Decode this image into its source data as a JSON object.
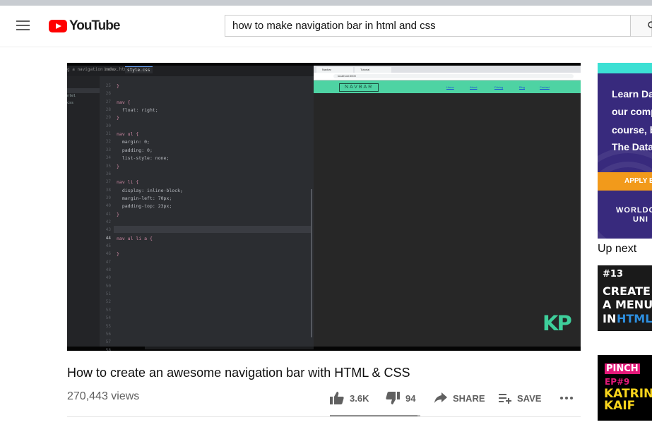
{
  "header": {
    "logo_text": "YouTube",
    "search_value": "how to make navigation bar in html and css"
  },
  "player": {
    "editor_tabs": [
      "g a navigation menu",
      "index.html",
      "style.css"
    ],
    "tree_items": [
      "",
      "ntel",
      "css"
    ],
    "line_numbers": [
      "25",
      "26",
      "27",
      "28",
      "29",
      "30",
      "31",
      "32",
      "33",
      "34",
      "35",
      "36",
      "37",
      "38",
      "39",
      "40",
      "41",
      "42",
      "43",
      "44",
      "45",
      "46",
      "47",
      "48",
      "49",
      "50",
      "51",
      "52",
      "53",
      "54",
      "55",
      "56",
      "57",
      "58"
    ],
    "current_line": "44",
    "code_lines": [
      {
        "text": "}",
        "line": 0
      },
      {
        "text": "nav {",
        "line": 2
      },
      {
        "text": "  float: right;",
        "line": 3
      },
      {
        "text": "}",
        "line": 4
      },
      {
        "text": "nav ul {",
        "line": 6
      },
      {
        "text": "  margin: 0;",
        "line": 7
      },
      {
        "text": "  padding: 0;",
        "line": 8
      },
      {
        "text": "  list-style: none;",
        "line": 9
      },
      {
        "text": "}",
        "line": 10
      },
      {
        "text": "nav li {",
        "line": 12
      },
      {
        "text": "  display: inline-block;",
        "line": 13
      },
      {
        "text": "  margin-left: 70px;",
        "line": 14
      },
      {
        "text": "  padding-top: 23px;",
        "line": 15
      },
      {
        "text": "}",
        "line": 16
      },
      {
        "text": "nav ul li a {",
        "line": 19
      },
      {
        "text": "}",
        "line": 21
      }
    ],
    "browser_tabs": [
      "Navbar",
      "Tutorial"
    ],
    "browser_url": "localhost:3000",
    "demo_brand": "NAVBAR",
    "demo_links": [
      "Home",
      "About",
      "Pricing",
      "Blog",
      "Contact"
    ],
    "watermark": "KP"
  },
  "video": {
    "title": "How to create an awesome navigation bar with HTML & CSS",
    "views": "270,443 views",
    "likes": "3.6K",
    "dislikes": "94",
    "share_label": "SHARE",
    "save_label": "SAVE",
    "like_ratio": 0.97
  },
  "sidebar": {
    "ad_lines": [
      "Learn Da",
      "our comp",
      "course, b",
      "The Data"
    ],
    "ad_button": "APPLY B",
    "ad_brand": [
      "WORLDO",
      "UNI"
    ],
    "up_next_label": "Up next",
    "video1": {
      "number": "#13",
      "lines": [
        "CREATE",
        "A MENU"
      ],
      "prefix": "IN",
      "highlight": "HTML"
    },
    "video2": {
      "top": "PINCH",
      "episode": "EP#9",
      "lines": [
        "KATRINA",
        "KAIF"
      ]
    }
  },
  "colors": {
    "brand_red": "#ff0000",
    "demo_navbar": "#4ed3a3",
    "ad_purple": "#382a7d",
    "ad_orange": "#f29a1b",
    "html_blue": "#2d8fe0",
    "pinch_pink": "#e5197a",
    "katrina_yellow": "#f8d41c"
  }
}
